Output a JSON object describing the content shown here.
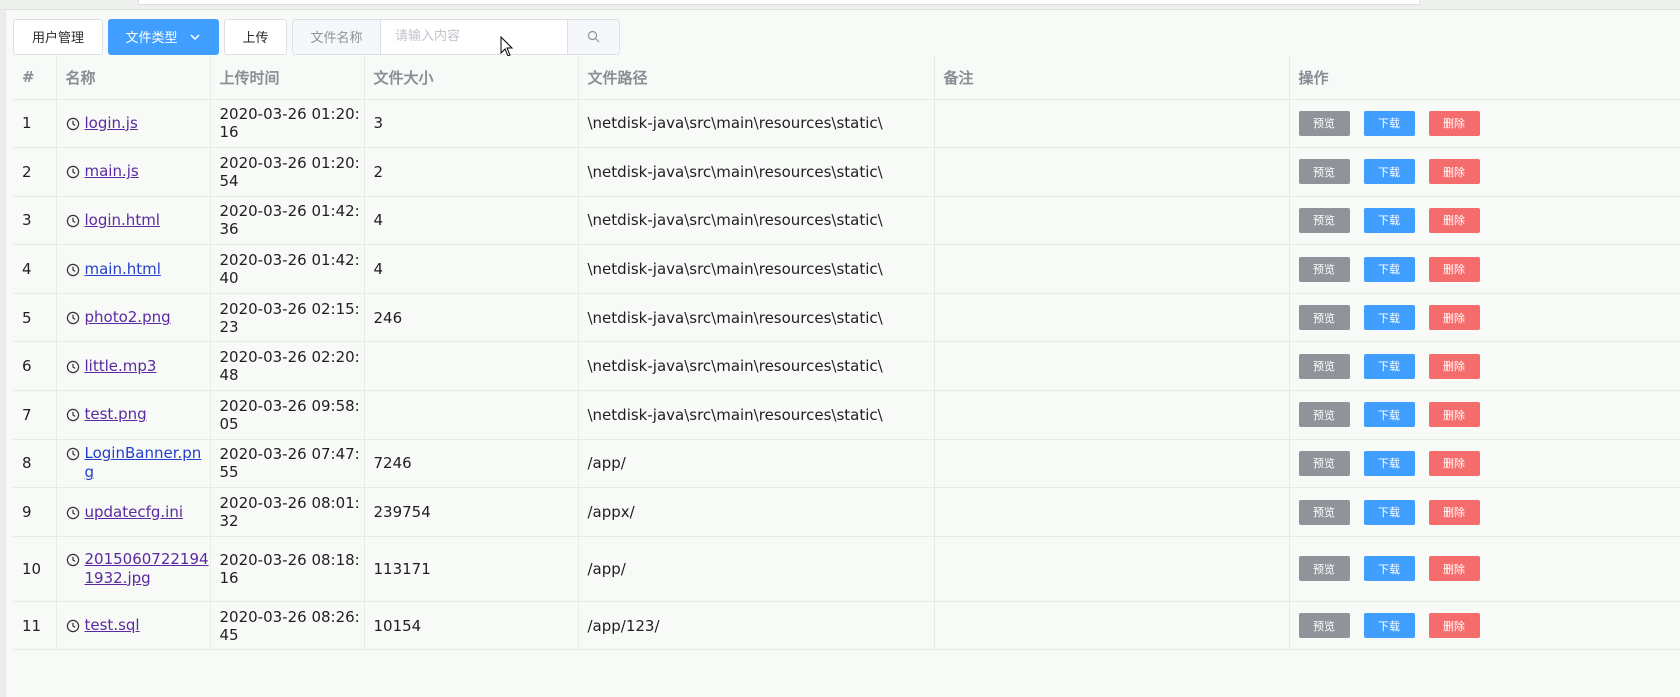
{
  "toolbar": {
    "user_mgmt_label": "用户管理",
    "file_type_label": "文件类型",
    "upload_label": "上传",
    "search_prefix": "文件名称",
    "search_placeholder": "请输入内容",
    "search_value": ""
  },
  "table": {
    "headers": [
      "#",
      "名称",
      "上传时间",
      "文件大小",
      "文件路径",
      "备注",
      "操作"
    ],
    "actions": {
      "preview": "预览",
      "download": "下载",
      "delete": "删除"
    },
    "rows": [
      {
        "index": "1",
        "name": "login.js",
        "time": "2020-03-26 01:20:16",
        "size": "3",
        "path": "\\netdisk-java\\src\\main\\resources\\static\\",
        "note": ""
      },
      {
        "index": "2",
        "name": "main.js",
        "time": "2020-03-26 01:20:54",
        "size": "2",
        "path": "\\netdisk-java\\src\\main\\resources\\static\\",
        "note": ""
      },
      {
        "index": "3",
        "name": "login.html",
        "time": "2020-03-26 01:42:36",
        "size": "4",
        "path": "\\netdisk-java\\src\\main\\resources\\static\\",
        "note": ""
      },
      {
        "index": "4",
        "name": "main.html",
        "time": "2020-03-26 01:42:40",
        "size": "4",
        "path": "\\netdisk-java\\src\\main\\resources\\static\\",
        "note": ""
      },
      {
        "index": "5",
        "name": "photo2.png",
        "time": "2020-03-26 02:15:23",
        "size": "246",
        "path": "\\netdisk-java\\src\\main\\resources\\static\\",
        "note": ""
      },
      {
        "index": "6",
        "name": "little.mp3",
        "time": "2020-03-26 02:20:48",
        "size": "",
        "path": "\\netdisk-java\\src\\main\\resources\\static\\",
        "note": ""
      },
      {
        "index": "7",
        "name": "test.png",
        "time": "2020-03-26 09:58:05",
        "size": "",
        "path": "\\netdisk-java\\src\\main\\resources\\static\\",
        "note": ""
      },
      {
        "index": "8",
        "name": "LoginBanner.png",
        "time": "2020-03-26 07:47:55",
        "size": "7246",
        "path": "/app/",
        "note": ""
      },
      {
        "index": "9",
        "name": "updatecfg.ini",
        "time": "2020-03-26 08:01:32",
        "size": "239754",
        "path": "/appx/",
        "note": ""
      },
      {
        "index": "10",
        "name": "20150607221941932.jpg",
        "time": "2020-03-26 08:18:16",
        "size": "113171",
        "path": "/app/",
        "note": ""
      },
      {
        "index": "11",
        "name": "test.sql",
        "time": "2020-03-26 08:26:45",
        "size": "10154",
        "path": "/app/123/",
        "note": ""
      }
    ]
  }
}
